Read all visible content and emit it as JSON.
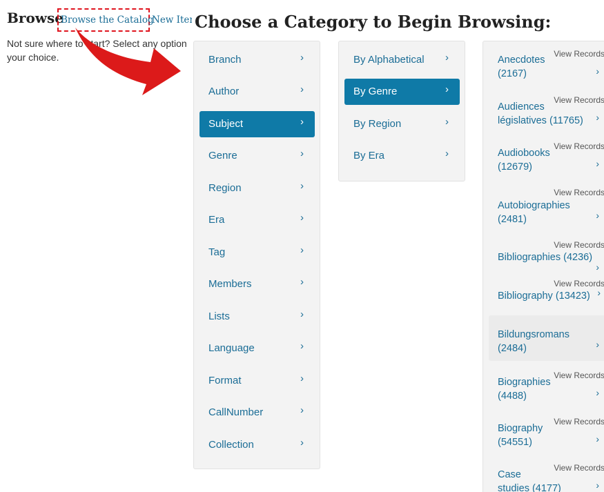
{
  "header": {
    "browse_title": "Browse",
    "link_catalog": "Browse the Catalog",
    "link_new_items": "New Items",
    "intro_line1": "Not sure where to start? Select any option",
    "intro_line2": "your choice.",
    "main_heading": "Choose a Category to Begin Browsing:"
  },
  "categories": [
    {
      "label": "Branch",
      "active": false
    },
    {
      "label": "Author",
      "active": false
    },
    {
      "label": "Subject",
      "active": true
    },
    {
      "label": "Genre",
      "active": false
    },
    {
      "label": "Region",
      "active": false
    },
    {
      "label": "Era",
      "active": false
    },
    {
      "label": "Tag",
      "active": false
    },
    {
      "label": "Members",
      "active": false
    },
    {
      "label": "Lists",
      "active": false
    },
    {
      "label": "Language",
      "active": false
    },
    {
      "label": "Format",
      "active": false
    },
    {
      "label": "CallNumber",
      "active": false
    },
    {
      "label": "Collection",
      "active": false
    }
  ],
  "subcategories": [
    {
      "label": "By Alphabetical",
      "active": false
    },
    {
      "label": "By Genre",
      "active": true
    },
    {
      "label": "By Region",
      "active": false
    },
    {
      "label": "By Era",
      "active": false
    }
  ],
  "records": [
    {
      "line1": "Anecdotes",
      "line2": "(2167)",
      "view": "View Records"
    },
    {
      "line1": "Audiences",
      "line2": "législatives (11765)",
      "view": "View Records"
    },
    {
      "line1": "Audiobooks",
      "line2": "(12679)",
      "view": "View Records"
    },
    {
      "line1": "Autobiographies",
      "line2": "(2481)",
      "view": "View Records"
    },
    {
      "line1": "Bibliographies (4236)",
      "line2": "",
      "view": "View Records"
    },
    {
      "line1": "Bibliography (13423)",
      "line2": "",
      "view": "View Records"
    },
    {
      "line1": "Bildungsromans",
      "line2": "(2484)",
      "view": "",
      "highlighted": true
    },
    {
      "line1": "Biographies",
      "line2": "(4488)",
      "view": "View Records"
    },
    {
      "line1": "Biography",
      "line2": "(54551)",
      "view": "View Records"
    },
    {
      "line1": "Case",
      "line2": "studies (4177)",
      "view": "View Records"
    }
  ],
  "icons": {
    "chevron": "chevron-right-icon",
    "pointer_arrow": "red-curved-arrow"
  },
  "colors": {
    "link": "#1b6d96",
    "active_bg": "#0f7aa7",
    "annotation_red": "#e0141e"
  }
}
